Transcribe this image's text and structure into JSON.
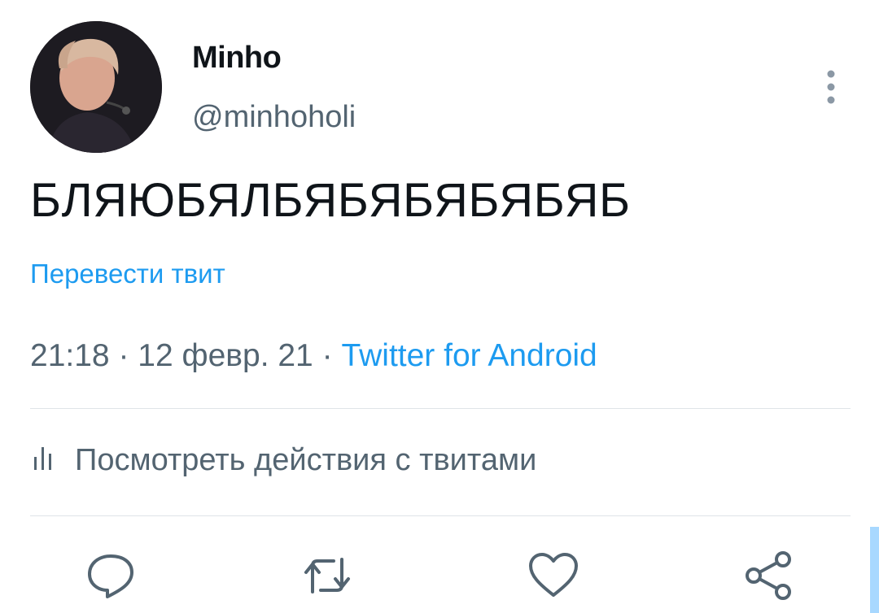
{
  "author": {
    "display_name": "Minho",
    "handle": "@minhoholi"
  },
  "tweet": {
    "text": "БЛЯЮБЯЛБЯБЯБЯБЯБЯБ",
    "translate_label": "Перевести твит",
    "time": "21:18",
    "date": "12 февр. 21",
    "source": "Twitter for Android",
    "separator": "·"
  },
  "analytics": {
    "label": "Посмотреть действия с твитами"
  },
  "icons": {
    "more": "more-vertical-icon",
    "analytics": "bar-chart-icon",
    "reply": "reply-icon",
    "retweet": "retweet-icon",
    "like": "heart-icon",
    "share": "share-icon"
  },
  "colors": {
    "link": "#1d9bf0",
    "secondary_text": "#536471",
    "primary_text": "#0f1419"
  }
}
